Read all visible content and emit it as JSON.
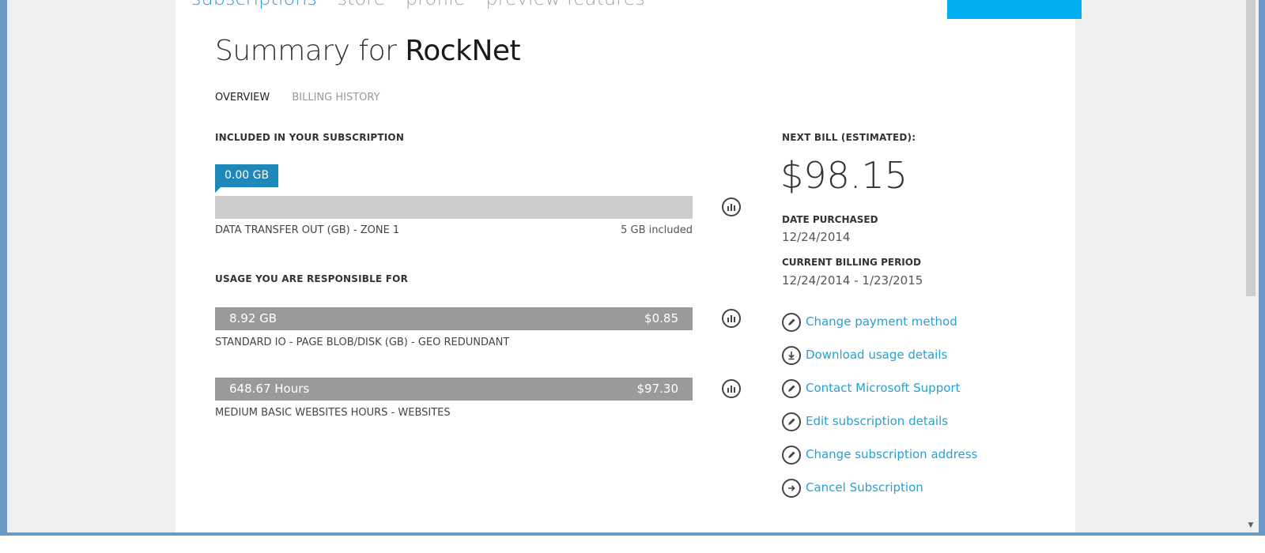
{
  "top_nav": {
    "items": [
      "subscriptions",
      "store",
      "profile",
      "preview features"
    ]
  },
  "title": {
    "prefix": "Summary for",
    "name": "RockNet"
  },
  "tabs": [
    {
      "label": "OVERVIEW",
      "active": true
    },
    {
      "label": "BILLING HISTORY",
      "active": false
    }
  ],
  "included": {
    "section_label": "INCLUDED IN YOUR SUBSCRIPTION",
    "usage_value": "0.00 GB",
    "name": "DATA TRANSFER OUT (GB) - ZONE 1",
    "allowance": "5 GB included"
  },
  "responsible": {
    "section_label": "USAGE YOU ARE RESPONSIBLE FOR",
    "items": [
      {
        "quantity": "8.92 GB",
        "cost": "$0.85",
        "name": "STANDARD IO - PAGE BLOB/DISK (GB) - GEO REDUNDANT"
      },
      {
        "quantity": "648.67 Hours",
        "cost": "$97.30",
        "name": "MEDIUM BASIC WEBSITES HOURS - WEBSITES"
      }
    ]
  },
  "billing": {
    "next_bill_label": "NEXT BILL (ESTIMATED):",
    "next_bill_amount": "$98.15",
    "date_purchased_label": "DATE PURCHASED",
    "date_purchased": "12/24/2014",
    "period_label": "CURRENT BILLING PERIOD",
    "period": "12/24/2014 - 1/23/2015"
  },
  "actions": [
    {
      "label": "Change payment method",
      "icon": "pencil-icon"
    },
    {
      "label": "Download usage details",
      "icon": "download-icon"
    },
    {
      "label": "Contact Microsoft Support",
      "icon": "pencil-icon"
    },
    {
      "label": "Edit subscription details",
      "icon": "pencil-icon"
    },
    {
      "label": "Change subscription address",
      "icon": "pencil-icon"
    },
    {
      "label": "Cancel Subscription",
      "icon": "arrow-right-icon"
    }
  ],
  "colors": {
    "link": "#2a9fd1",
    "accent": "#00aeef",
    "bubble": "#1e88b8",
    "usage_bar": "#9a9a9a",
    "included_bar": "#cccccc"
  }
}
